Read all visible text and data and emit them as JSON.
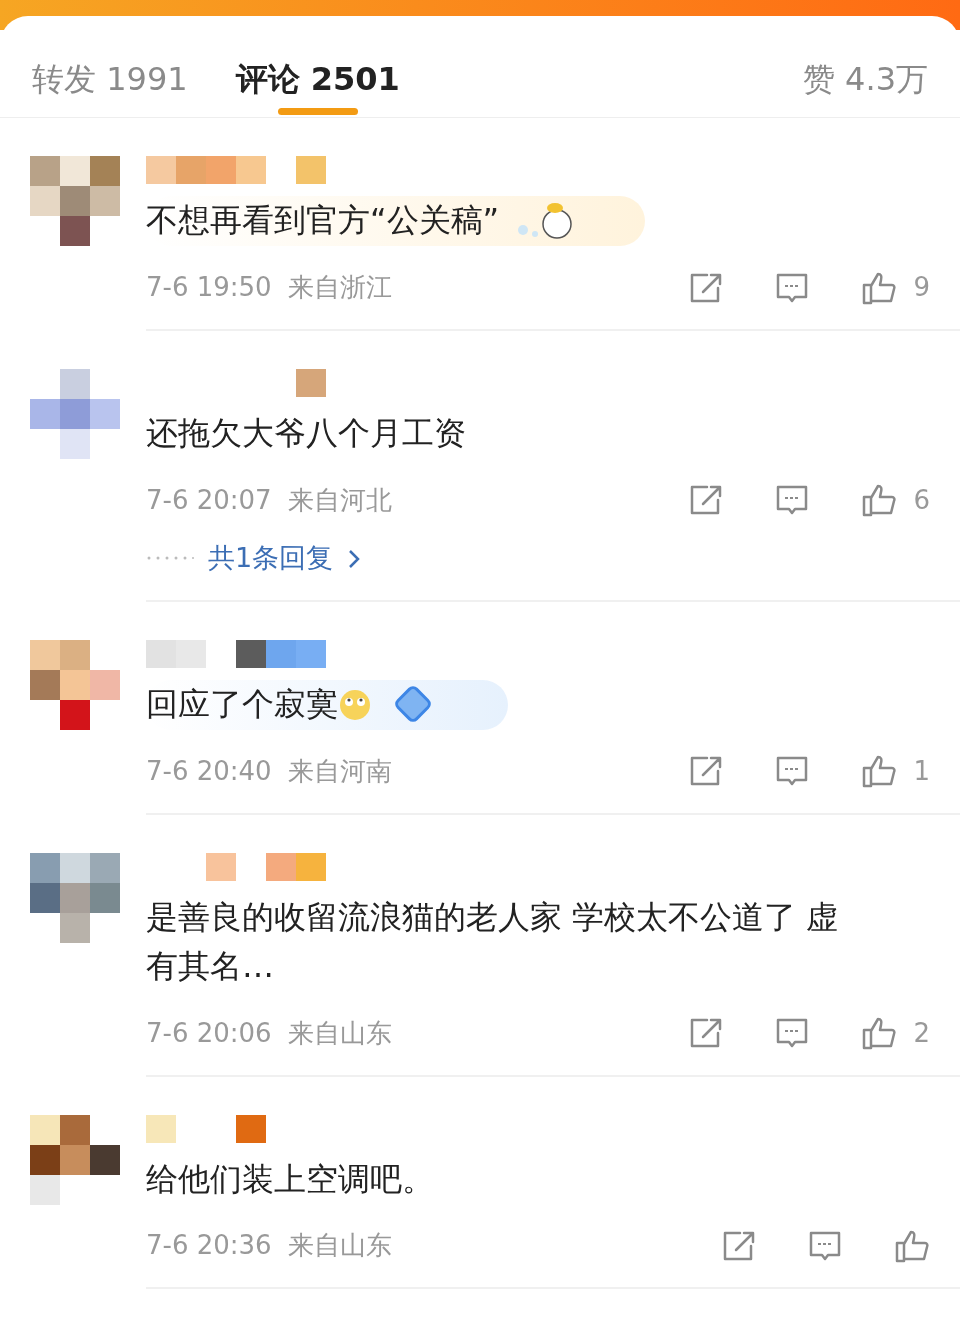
{
  "tabs": [
    {
      "label": "转发 1991",
      "selected": false
    },
    {
      "label": "评论 2501",
      "selected": true
    }
  ],
  "likes_total": "赞 4.3万",
  "comments": [
    {
      "text": "不想再看到官方“公关稿”",
      "time": "7-6 19:50",
      "location": "来自浙江",
      "likes": "9",
      "bubble": {
        "color": "#fff3dc",
        "kind": "sticker"
      }
    },
    {
      "text": "还拖欠大爷八个月工资",
      "time": "7-6 20:07",
      "location": "来自河北",
      "likes": "6",
      "replies": "共1条回复"
    },
    {
      "text": "回应了个寂寞",
      "emoji": true,
      "time": "7-6 20:40",
      "location": "来自河南",
      "likes": "1",
      "bubble": {
        "color": "#e6f1fd",
        "kind": "diamond"
      }
    },
    {
      "text": "是善良的收留流浪猫的老人家 学校太不公道了 虚有其名…",
      "time": "7-6 20:06",
      "location": "来自山东",
      "likes": "2"
    },
    {
      "text": "给他们装上空调吧。",
      "time": "7-6 20:36",
      "location": "来自山东"
    }
  ]
}
